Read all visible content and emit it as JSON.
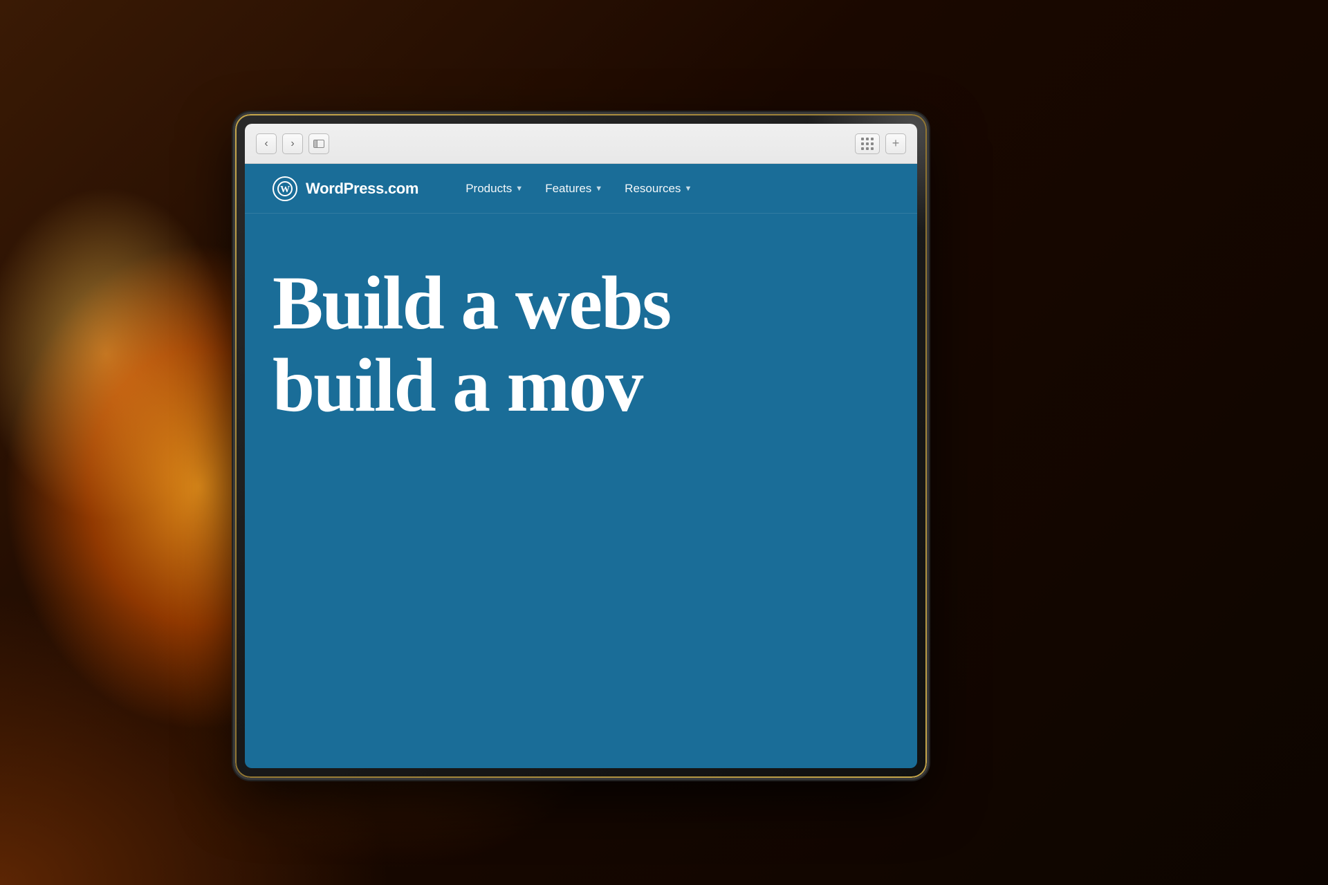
{
  "background": {
    "description": "Warm bokeh background with orange/amber light"
  },
  "device": {
    "type": "laptop/tablet",
    "frame_color": "#1e1e1e"
  },
  "browser": {
    "back_btn": "‹",
    "forward_btn": "›",
    "sidebar_btn": "sidebar",
    "grid_btn": "grid",
    "plus_btn": "+"
  },
  "website": {
    "brand": "WordPress.com",
    "logo_letter": "W",
    "nav": {
      "products_label": "Products",
      "products_arrow": "▼",
      "features_label": "Features",
      "features_arrow": "▼",
      "resources_label": "Resources",
      "resources_arrow": "▼"
    },
    "hero": {
      "line1": "Build a webs",
      "line2": "build a mov"
    },
    "bg_color": "#1a6d98"
  }
}
